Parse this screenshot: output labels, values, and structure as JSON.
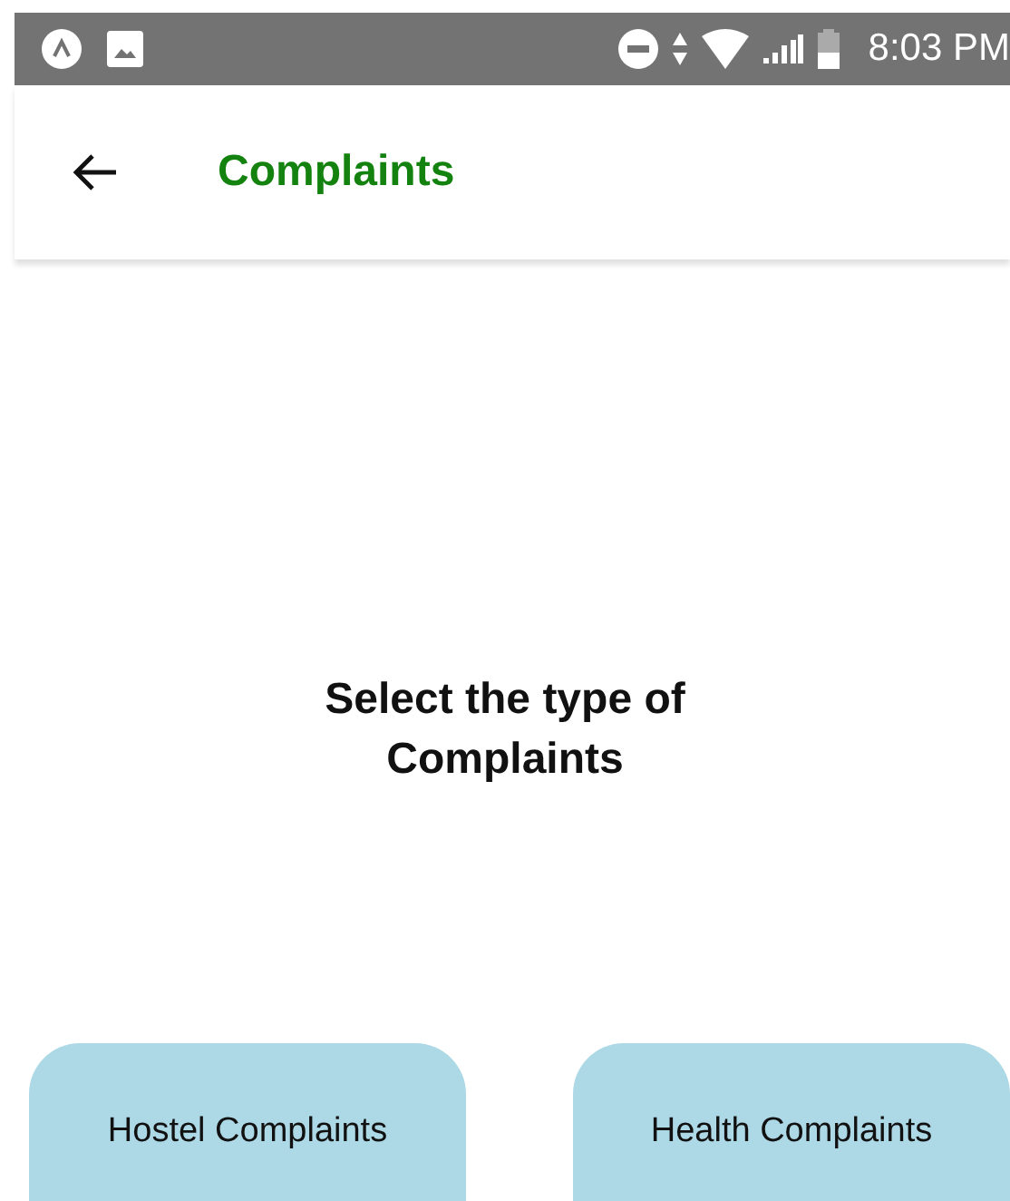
{
  "status_bar": {
    "time": "8:03 PM"
  },
  "header": {
    "title": "Complaints"
  },
  "prompt": "Select the type of Complaints",
  "buttons": [
    {
      "label": "Hostel Complaints"
    },
    {
      "label": "Health Complaints"
    }
  ]
}
